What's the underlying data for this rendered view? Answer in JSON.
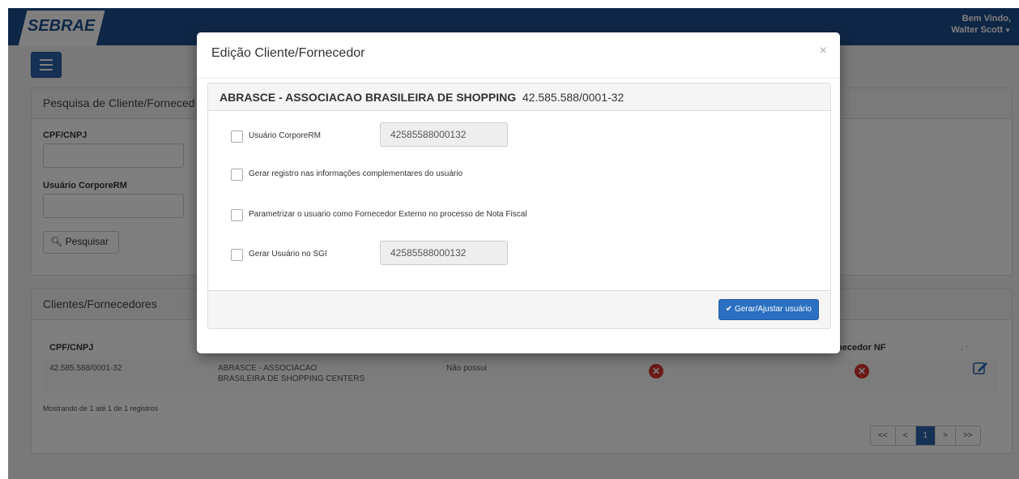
{
  "header": {
    "logo_text": "SEBRAE",
    "welcome_line1": "Bem Vindo,",
    "welcome_line2": "Walter Scott"
  },
  "search_panel": {
    "title": "Pesquisa de Cliente/Forneced",
    "cpf_label": "CPF/CNPJ",
    "cpf_value": "",
    "user_label": "Usuário CorporeRM",
    "user_value": "",
    "search_button": "Pesquisar"
  },
  "results_panel": {
    "title": "Clientes/Fornecedores",
    "columns": [
      "CPF/CNPJ",
      "necedor NF"
    ],
    "row": {
      "cnpj": "42.585.588/0001-32",
      "name_line1": "ABRASCE - ASSOCIACAO",
      "name_line2": "BRASILEIRA DE SHOPPING CENTERS",
      "user": "Não possui"
    },
    "showing": "Mostrando de 1 até 1 de 1 registros",
    "pagination": [
      "<<",
      "<",
      "1",
      ">",
      ">>"
    ]
  },
  "modal": {
    "title": "Edição Cliente/Fornecedor",
    "close": "×",
    "company_name": "ABRASCE - ASSOCIACAO BRASILEIRA DE SHOPPING",
    "company_cnpj": "42.585.588/0001-32",
    "opt_usuario_corporerm": "Usuário CorporeRM",
    "opt_usuario_corporerm_value": "42585588000132",
    "opt_gerar_registro": "Gerar registro nas informações complementares do usuário",
    "opt_parametrizar": "Parametrizar o usuario como Fornecedor Externo no processo de Nota Fiscal",
    "opt_gerar_sgi": "Gerar Usuário no SGI",
    "opt_gerar_sgi_value": "42585588000132",
    "submit_button": "Gerar/Ajustar usuário"
  },
  "colors": {
    "navbar": "#1f4f8c",
    "primary": "#2a6fc1",
    "danger": "#d9352c"
  }
}
